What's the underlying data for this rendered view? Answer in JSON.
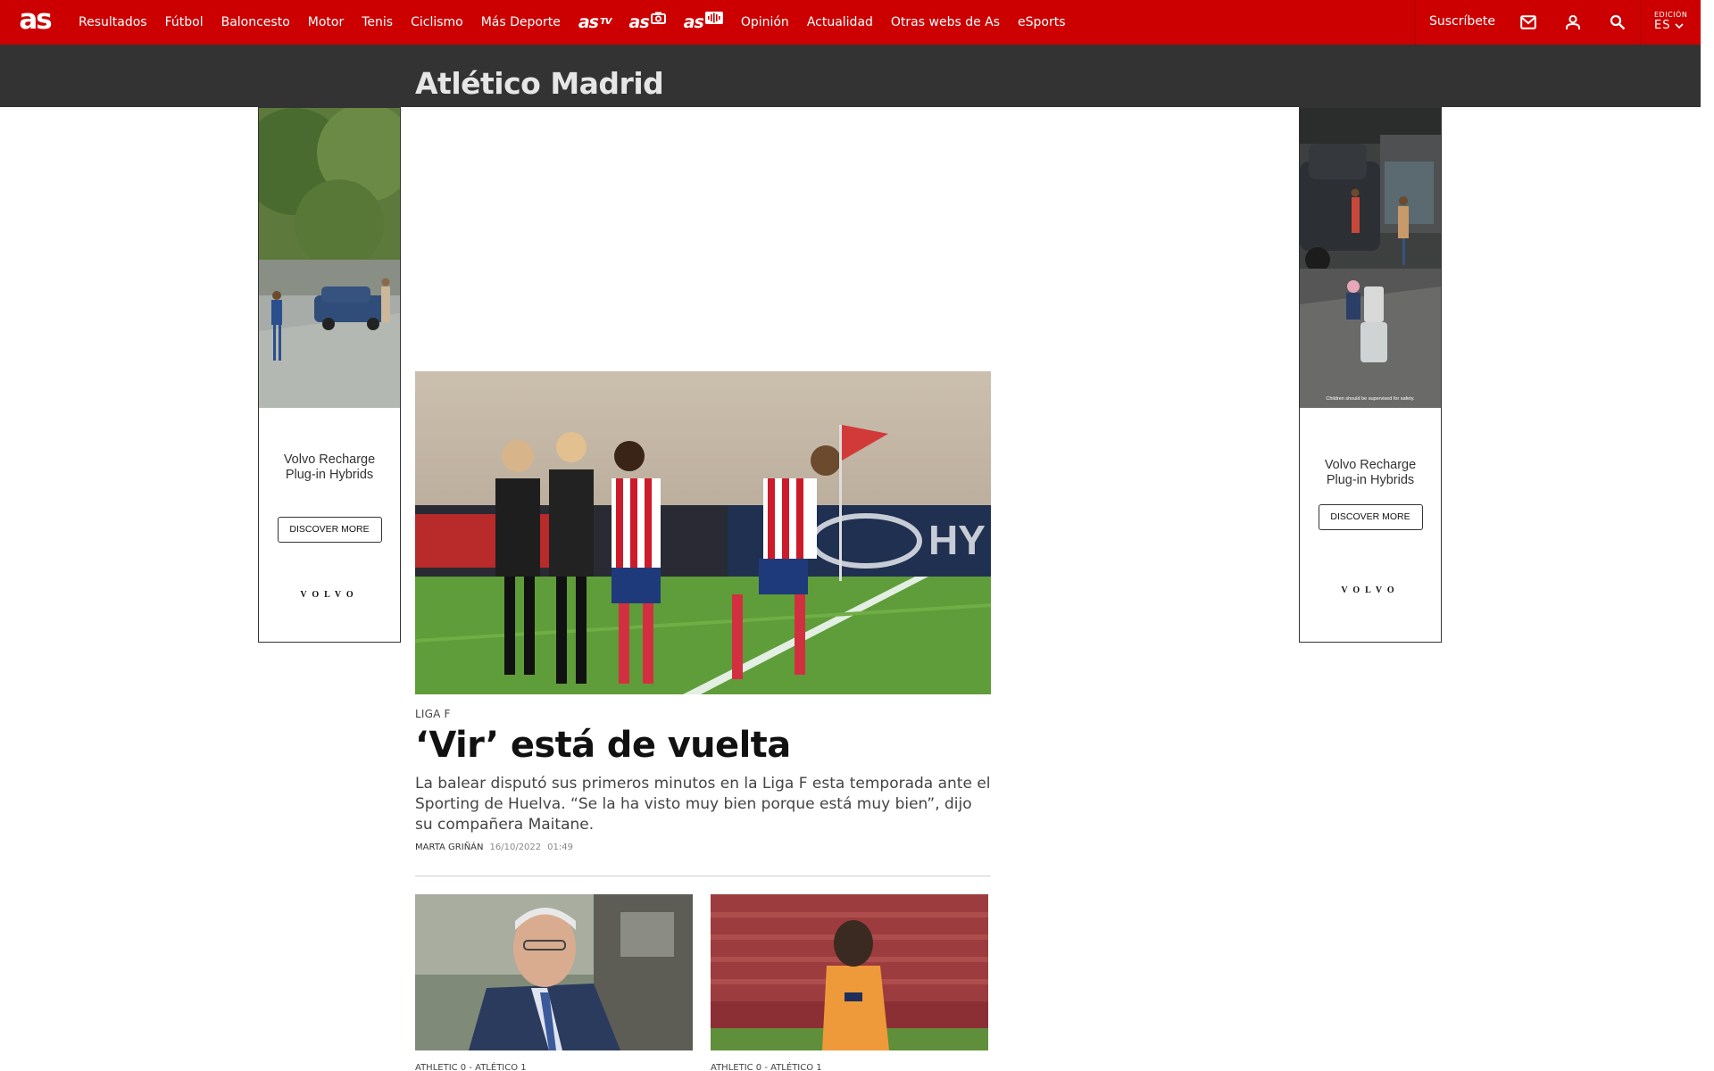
{
  "nav": {
    "logo_text": "as",
    "items": [
      {
        "label": "Resultados"
      },
      {
        "label": "Fútbol"
      },
      {
        "label": "Baloncesto"
      },
      {
        "label": "Motor"
      },
      {
        "label": "Tenis"
      },
      {
        "label": "Ciclismo"
      },
      {
        "label": "Más Deporte"
      }
    ],
    "brands": [
      {
        "label": "as",
        "tag": "TV"
      },
      {
        "label": "as",
        "tag": "◘"
      },
      {
        "label": "as",
        "tag": "4lb"
      }
    ],
    "items2": [
      {
        "label": "Opinión"
      },
      {
        "label": "Actualidad"
      },
      {
        "label": "Otras webs de As"
      },
      {
        "label": "eSports"
      }
    ],
    "subscribe": "Suscríbete",
    "icons": [
      "mail-icon",
      "user-icon",
      "search-icon"
    ],
    "edition_label": "EDICIÓN",
    "edition_value": "ES"
  },
  "section": {
    "title": "Atlético Madrid"
  },
  "ads": {
    "left": {
      "line1": "Volvo Recharge",
      "line2": "Plug-in Hybrids",
      "button": "DISCOVER MORE",
      "brand": "VOLVO"
    },
    "right": {
      "line1": "Volvo Recharge",
      "line2": "Plug-in Hybrids",
      "button": "DISCOVER MORE",
      "brand": "VOLVO",
      "small_print": "Children should be supervised for safety."
    }
  },
  "main": {
    "lead": {
      "kicker": "LIGA F",
      "headline": "‘Vir’ está de vuelta",
      "summary": "La balear disputó sus primeros minutos en la Liga F esta temporada ante el Sporting de Huelva. “Se la ha visto muy bien porque está muy bien”, dijo su compañera Maitane.",
      "author": "MARTA GRIÑÁN",
      "date": "16/10/2022",
      "time": "01:49"
    },
    "cards": [
      {
        "kicker": "ATHLETIC 0 - ATLÉTICO 1"
      },
      {
        "kicker": "ATHLETIC 0 - ATLÉTICO 1"
      }
    ]
  },
  "colors": {
    "brand_red": "#cc0000",
    "section_bar": "#333333"
  }
}
